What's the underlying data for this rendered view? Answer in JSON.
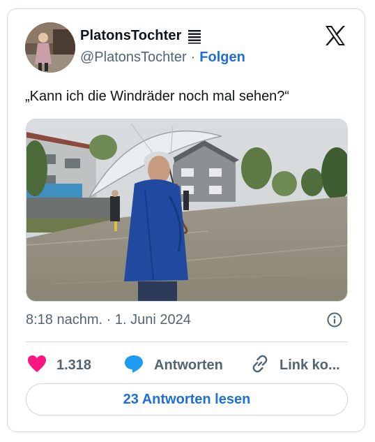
{
  "user": {
    "display_name": "PlatonsTochter",
    "handle": "@PlatonsTochter",
    "separator": "·",
    "follow_label": "Folgen"
  },
  "tweet": {
    "text": "„Kann ich die Windräder noch mal sehen?“",
    "timestamp": "8:18 nachm. · 1. Juni 2024"
  },
  "actions": {
    "like_count": "1.318",
    "reply_label": "Antworten",
    "link_label": "Link ko..."
  },
  "read_replies_label": "23 Antworten lesen",
  "colors": {
    "accent": "#1d6fd6",
    "like": "#f91880",
    "reply": "#1d9bf0",
    "border": "#cfd9de",
    "muted": "#536471"
  },
  "icons": [
    "verified-badge-icon",
    "x-logo-icon",
    "info-icon",
    "heart-icon",
    "reply-bubble-icon",
    "link-icon"
  ]
}
